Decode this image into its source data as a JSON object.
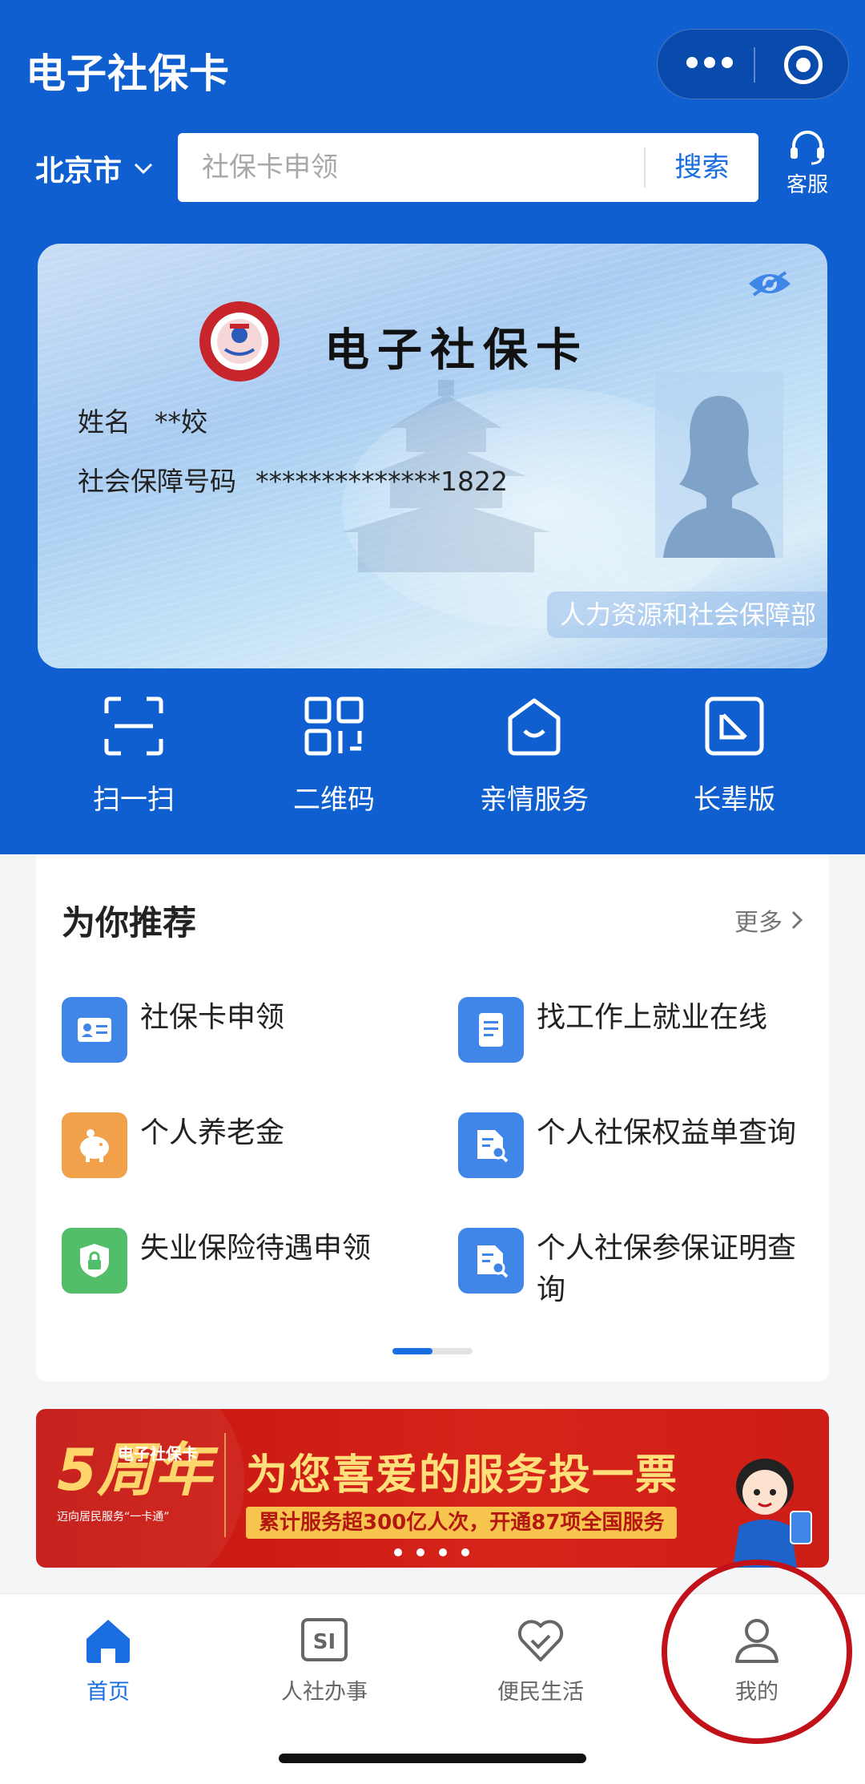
{
  "header": {
    "title": "电子社保卡",
    "city": "北京市",
    "service_label": "客服"
  },
  "search": {
    "placeholder": "社保卡申领",
    "button_label": "搜索"
  },
  "card": {
    "title": "电子社保卡",
    "name_label": "姓名",
    "name_value": "**姣",
    "ssn_label": "社会保障号码",
    "ssn_value": "**************1822",
    "issuer": "人力资源和社会保障部"
  },
  "quick_actions": [
    {
      "label": "扫一扫",
      "icon": "scan-icon"
    },
    {
      "label": "二维码",
      "icon": "qrcode-icon"
    },
    {
      "label": "亲情服务",
      "icon": "family-service-icon"
    },
    {
      "label": "长辈版",
      "icon": "elder-mode-icon"
    }
  ],
  "recommend": {
    "title": "为你推荐",
    "more_label": "更多",
    "items": [
      {
        "label": "社保卡申领",
        "icon": "id-card-icon",
        "color": "#3f86e8"
      },
      {
        "label": "找工作上就业在线",
        "icon": "document-icon",
        "color": "#3f86e8"
      },
      {
        "label": "个人养老金",
        "icon": "piggy-bank-icon",
        "color": "#f2a14b"
      },
      {
        "label": "个人社保权益单查询",
        "icon": "record-search-icon",
        "color": "#3f86e8"
      },
      {
        "label": "失业保险待遇申领",
        "icon": "shield-lock-icon",
        "color": "#52be6a"
      },
      {
        "label": "个人社保参保证明查询",
        "icon": "record-search-icon",
        "color": "#3f86e8"
      }
    ]
  },
  "banner": {
    "badge_small": "电子社保卡",
    "badge_big": "5周年",
    "badge_caption": "迈向居民服务“一卡通”",
    "headline": "为您喜爱的服务投一票",
    "subline": "累计服务超300亿人次，开通87项全国服务"
  },
  "tabbar": [
    {
      "label": "首页",
      "icon": "home-icon",
      "active": true
    },
    {
      "label": "人社办事",
      "icon": "si-icon",
      "active": false
    },
    {
      "label": "便民生活",
      "icon": "heart-handshake-icon",
      "active": false
    },
    {
      "label": "我的",
      "icon": "user-icon",
      "active": false
    }
  ],
  "colors": {
    "primary": "#0f5fd0",
    "accent": "#1a6ee0",
    "highlight_ring": "#c1121a"
  }
}
